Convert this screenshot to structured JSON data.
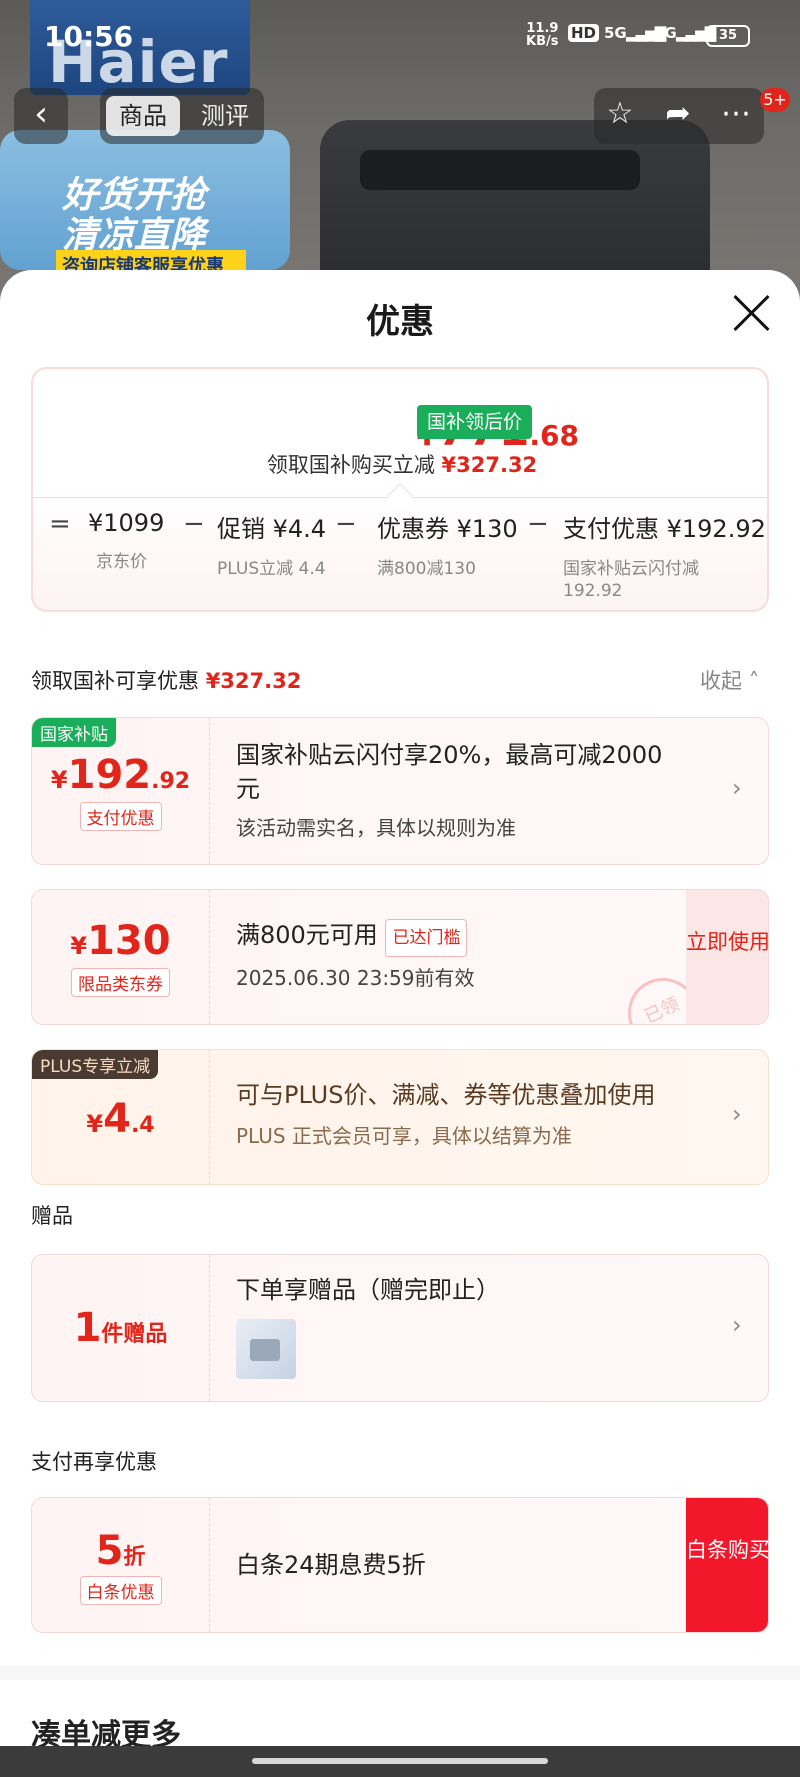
{
  "status": {
    "time": "10:56",
    "net_speed_top": "11.9",
    "net_speed_bottom": "KB/s",
    "hd": "HD",
    "sig1": "5G",
    "sig2": "5G",
    "battery": "35"
  },
  "background": {
    "brand": "Haier",
    "promo_line1": "好货开抢",
    "promo_line2": "清凉直降",
    "promo_line3": "咨询店铺客服享优惠"
  },
  "nav": {
    "back_icon": "‹",
    "tab_goods": "商品",
    "tab_review": "测评",
    "star_icon": "☆",
    "share_icon": "➦",
    "more_icon": "⋯",
    "badge": "5+"
  },
  "sheet": {
    "title": "优惠"
  },
  "summary": {
    "currency": "¥",
    "price_int": "771",
    "price_dec": ".68",
    "price_tag": "国补领后价",
    "get_text": "领取国补购买立减",
    "get_amount": "¥327.32",
    "eq": "=",
    "minus": "−",
    "items": [
      {
        "main": "¥1099",
        "sub": "京东价"
      },
      {
        "main": "促销 ¥4.4",
        "sub": "PLUS立减 4.4"
      },
      {
        "main": "优惠券 ¥130",
        "sub": "满800减130"
      },
      {
        "main": "支付优惠 ¥192.92",
        "sub": "国家补贴云闪付减 192.92"
      }
    ]
  },
  "section_discounts": {
    "label": "领取国补可享优惠",
    "amount": "¥327.32",
    "collapse": "收起"
  },
  "card_subsidy": {
    "tag": "国家补贴",
    "currency": "¥",
    "amount_int": "192",
    "amount_dec": ".92",
    "badge": "支付优惠",
    "title": "国家补贴云闪付享20%，最高可减2000元",
    "subtitle": "该活动需实名，具体以规则为准",
    "chevron": "›"
  },
  "card_coupon": {
    "currency": "¥",
    "amount": "130",
    "badge": "限品类东券",
    "title": "满800元可用",
    "status": "已达门槛",
    "validity": "2025.06.30 23:59前有效",
    "action": "立即使用",
    "stamp": "已领"
  },
  "card_plus": {
    "tag": "PLUS专享立减",
    "currency": "¥",
    "amount_int": "4",
    "amount_dec": ".4",
    "title": "可与PLUS价、满减、券等优惠叠加使用",
    "subtitle": "PLUS 正式会员可享，具体以结算为准",
    "chevron": "›"
  },
  "section_gift": {
    "label": "赠品"
  },
  "card_gift": {
    "count": "1",
    "unit": "件赠品",
    "title": "下单享赠品（赠完即止）",
    "chevron": "›"
  },
  "section_pay": {
    "label": "支付再享优惠"
  },
  "card_baitiao": {
    "amount": "5",
    "unit": "折",
    "badge": "白条优惠",
    "title": "白条24期息费5折",
    "action": "白条购买"
  },
  "section_more": {
    "label": "凑单减更多"
  },
  "colors": {
    "accent_red": "#e1251b",
    "green_tag": "#1bae5a",
    "plus_dark": "#4a3a31"
  }
}
